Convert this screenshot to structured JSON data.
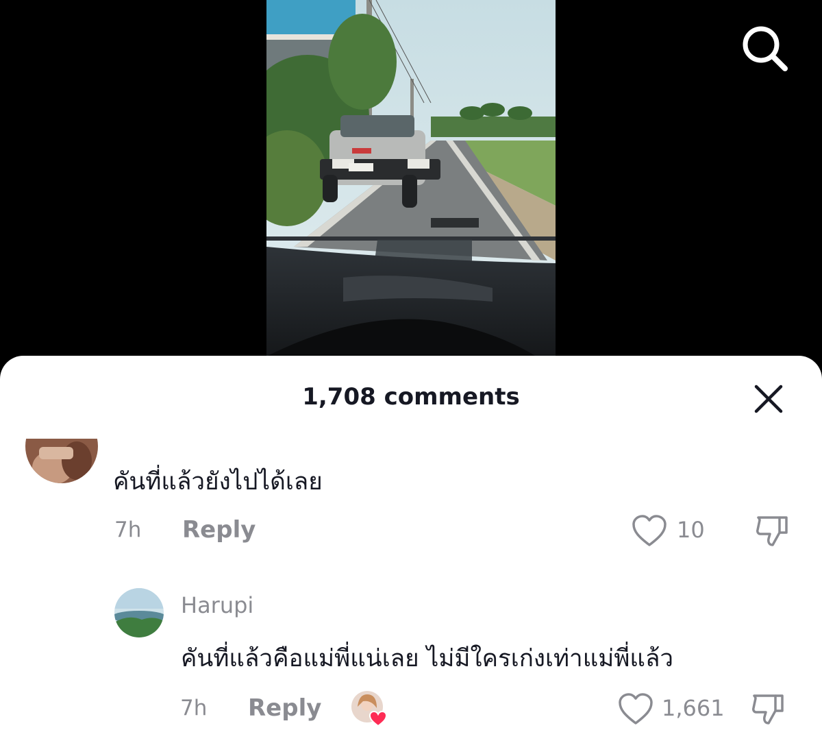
{
  "header": {
    "search_icon": "search-icon"
  },
  "sheet": {
    "title": "1,708 comments",
    "close_icon": "close-icon"
  },
  "comments": [
    {
      "username": "",
      "text": "คันที่แล้วยังไปได้เลย",
      "time": "7h",
      "reply_label": "Reply",
      "likes": "10"
    },
    {
      "username": "Harupi",
      "text": "คันที่แล้วคือแม่พี่แน่เลย ไม่มีใครเก่งเท่าแม่พี่แล้ว",
      "time": "7h",
      "reply_label": "Reply",
      "likes": "1,661",
      "liked_by_creator": true
    }
  ],
  "colors": {
    "text_primary": "#161823",
    "text_secondary": "#8a8b91",
    "creator_heart": "#fe2c55"
  }
}
